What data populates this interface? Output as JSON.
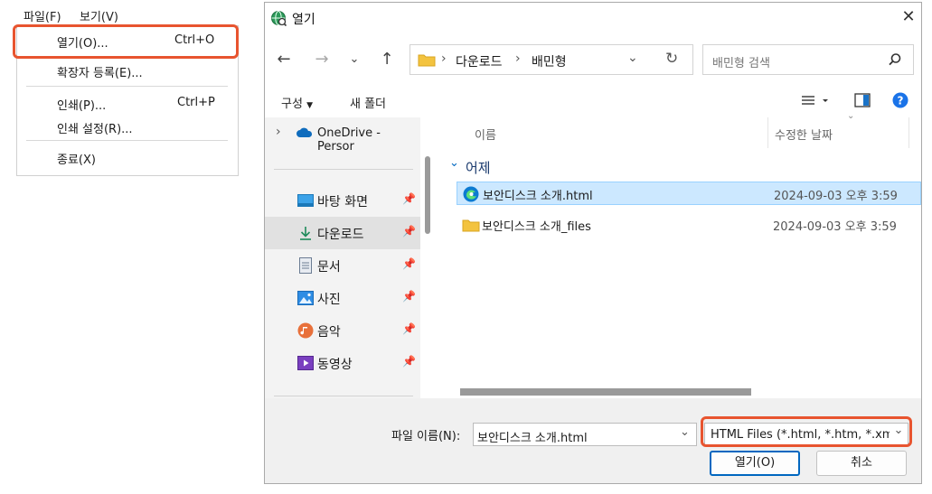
{
  "menu": {
    "bar": {
      "file": "파일(F)",
      "view": "보기(V)"
    },
    "items": {
      "open": {
        "label": "열기(O)...",
        "shortcut": "Ctrl+O"
      },
      "extensions": {
        "label": "확장자 등록(E)..."
      },
      "print": {
        "label": "인쇄(P)...",
        "shortcut": "Ctrl+P"
      },
      "print_setup": {
        "label": "인쇄 설정(R)..."
      },
      "exit": {
        "label": "종료(X)"
      }
    }
  },
  "dialog": {
    "title": "열기",
    "breadcrumb": [
      "다운로드",
      "배민형"
    ],
    "search_placeholder": "배민형 검색",
    "toolbar": {
      "organize": "구성",
      "new_folder": "새 폴더"
    },
    "nav": [
      {
        "label": "OneDrive - Persor"
      },
      {
        "label": "바탕 화면"
      },
      {
        "label": "다운로드"
      },
      {
        "label": "문서"
      },
      {
        "label": "사진"
      },
      {
        "label": "음악"
      },
      {
        "label": "동영상"
      }
    ],
    "columns": {
      "name": "이름",
      "modified": "수정한 날짜"
    },
    "group": "어제",
    "files": [
      {
        "name": "보안디스크 소개.html",
        "date": "2024-09-03 오후 3:59"
      },
      {
        "name": "보안디스크 소개_files",
        "date": "2024-09-03 오후 3:59"
      }
    ],
    "filename_label": "파일 이름(N):",
    "filename_value": "보안디스크 소개.html",
    "filetype": "HTML Files (*.html, *.htm, *.xm",
    "open_button": "열기(O)",
    "cancel_button": "취소"
  },
  "colors": {
    "highlight": "#e8542f",
    "selection": "#cce8ff",
    "accent": "#0067c0"
  }
}
